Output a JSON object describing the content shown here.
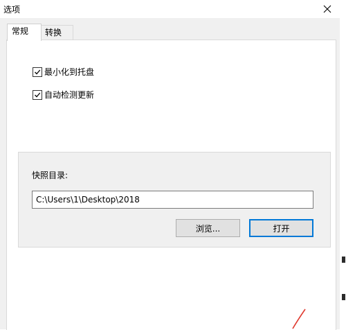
{
  "window": {
    "title": "选项"
  },
  "tabs": [
    {
      "label": "常规",
      "active": true
    },
    {
      "label": "转换",
      "active": false
    }
  ],
  "general": {
    "minimize_to_tray": {
      "label": "最小化到托盘",
      "checked": true
    },
    "auto_check_updates": {
      "label": "自动检测更新",
      "checked": true
    }
  },
  "snapshot": {
    "label": "快照目录:",
    "path": "C:\\Users\\1\\Desktop\\2018",
    "browse_label": "浏览...",
    "open_label": "打开"
  },
  "colors": {
    "window_bg": "#f0f0f0",
    "panel_bg": "#ffffff",
    "default_button_border": "#0078d7",
    "annotation": "#e03a2f"
  }
}
